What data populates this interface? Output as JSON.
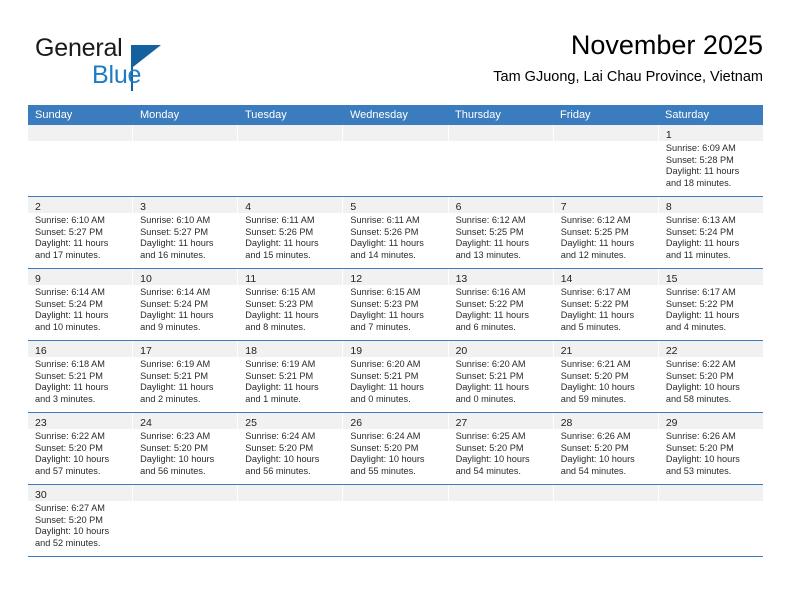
{
  "brand": {
    "word1": "General",
    "word2": "Blue",
    "logo_icon": "triangle-flag-icon"
  },
  "header": {
    "title": "November 2025",
    "subtitle": "Tam GJuong, Lai Chau Province, Vietnam"
  },
  "calendar": {
    "weekday_headers": [
      "Sunday",
      "Monday",
      "Tuesday",
      "Wednesday",
      "Thursday",
      "Friday",
      "Saturday"
    ],
    "accent_color": "#3a7cbd",
    "daycell_header_color": "#f1f1f1",
    "weeks": [
      [
        {
          "day": "",
          "empty": true
        },
        {
          "day": "",
          "empty": true
        },
        {
          "day": "",
          "empty": true
        },
        {
          "day": "",
          "empty": true
        },
        {
          "day": "",
          "empty": true
        },
        {
          "day": "",
          "empty": true
        },
        {
          "day": "1",
          "sunrise": "Sunrise: 6:09 AM",
          "sunset": "Sunset: 5:28 PM",
          "daylight1": "Daylight: 11 hours",
          "daylight2": "and 18 minutes."
        }
      ],
      [
        {
          "day": "2",
          "sunrise": "Sunrise: 6:10 AM",
          "sunset": "Sunset: 5:27 PM",
          "daylight1": "Daylight: 11 hours",
          "daylight2": "and 17 minutes."
        },
        {
          "day": "3",
          "sunrise": "Sunrise: 6:10 AM",
          "sunset": "Sunset: 5:27 PM",
          "daylight1": "Daylight: 11 hours",
          "daylight2": "and 16 minutes."
        },
        {
          "day": "4",
          "sunrise": "Sunrise: 6:11 AM",
          "sunset": "Sunset: 5:26 PM",
          "daylight1": "Daylight: 11 hours",
          "daylight2": "and 15 minutes."
        },
        {
          "day": "5",
          "sunrise": "Sunrise: 6:11 AM",
          "sunset": "Sunset: 5:26 PM",
          "daylight1": "Daylight: 11 hours",
          "daylight2": "and 14 minutes."
        },
        {
          "day": "6",
          "sunrise": "Sunrise: 6:12 AM",
          "sunset": "Sunset: 5:25 PM",
          "daylight1": "Daylight: 11 hours",
          "daylight2": "and 13 minutes."
        },
        {
          "day": "7",
          "sunrise": "Sunrise: 6:12 AM",
          "sunset": "Sunset: 5:25 PM",
          "daylight1": "Daylight: 11 hours",
          "daylight2": "and 12 minutes."
        },
        {
          "day": "8",
          "sunrise": "Sunrise: 6:13 AM",
          "sunset": "Sunset: 5:24 PM",
          "daylight1": "Daylight: 11 hours",
          "daylight2": "and 11 minutes."
        }
      ],
      [
        {
          "day": "9",
          "sunrise": "Sunrise: 6:14 AM",
          "sunset": "Sunset: 5:24 PM",
          "daylight1": "Daylight: 11 hours",
          "daylight2": "and 10 minutes."
        },
        {
          "day": "10",
          "sunrise": "Sunrise: 6:14 AM",
          "sunset": "Sunset: 5:24 PM",
          "daylight1": "Daylight: 11 hours",
          "daylight2": "and 9 minutes."
        },
        {
          "day": "11",
          "sunrise": "Sunrise: 6:15 AM",
          "sunset": "Sunset: 5:23 PM",
          "daylight1": "Daylight: 11 hours",
          "daylight2": "and 8 minutes."
        },
        {
          "day": "12",
          "sunrise": "Sunrise: 6:15 AM",
          "sunset": "Sunset: 5:23 PM",
          "daylight1": "Daylight: 11 hours",
          "daylight2": "and 7 minutes."
        },
        {
          "day": "13",
          "sunrise": "Sunrise: 6:16 AM",
          "sunset": "Sunset: 5:22 PM",
          "daylight1": "Daylight: 11 hours",
          "daylight2": "and 6 minutes."
        },
        {
          "day": "14",
          "sunrise": "Sunrise: 6:17 AM",
          "sunset": "Sunset: 5:22 PM",
          "daylight1": "Daylight: 11 hours",
          "daylight2": "and 5 minutes."
        },
        {
          "day": "15",
          "sunrise": "Sunrise: 6:17 AM",
          "sunset": "Sunset: 5:22 PM",
          "daylight1": "Daylight: 11 hours",
          "daylight2": "and 4 minutes."
        }
      ],
      [
        {
          "day": "16",
          "sunrise": "Sunrise: 6:18 AM",
          "sunset": "Sunset: 5:21 PM",
          "daylight1": "Daylight: 11 hours",
          "daylight2": "and 3 minutes."
        },
        {
          "day": "17",
          "sunrise": "Sunrise: 6:19 AM",
          "sunset": "Sunset: 5:21 PM",
          "daylight1": "Daylight: 11 hours",
          "daylight2": "and 2 minutes."
        },
        {
          "day": "18",
          "sunrise": "Sunrise: 6:19 AM",
          "sunset": "Sunset: 5:21 PM",
          "daylight1": "Daylight: 11 hours",
          "daylight2": "and 1 minute."
        },
        {
          "day": "19",
          "sunrise": "Sunrise: 6:20 AM",
          "sunset": "Sunset: 5:21 PM",
          "daylight1": "Daylight: 11 hours",
          "daylight2": "and 0 minutes."
        },
        {
          "day": "20",
          "sunrise": "Sunrise: 6:20 AM",
          "sunset": "Sunset: 5:21 PM",
          "daylight1": "Daylight: 11 hours",
          "daylight2": "and 0 minutes."
        },
        {
          "day": "21",
          "sunrise": "Sunrise: 6:21 AM",
          "sunset": "Sunset: 5:20 PM",
          "daylight1": "Daylight: 10 hours",
          "daylight2": "and 59 minutes."
        },
        {
          "day": "22",
          "sunrise": "Sunrise: 6:22 AM",
          "sunset": "Sunset: 5:20 PM",
          "daylight1": "Daylight: 10 hours",
          "daylight2": "and 58 minutes."
        }
      ],
      [
        {
          "day": "23",
          "sunrise": "Sunrise: 6:22 AM",
          "sunset": "Sunset: 5:20 PM",
          "daylight1": "Daylight: 10 hours",
          "daylight2": "and 57 minutes."
        },
        {
          "day": "24",
          "sunrise": "Sunrise: 6:23 AM",
          "sunset": "Sunset: 5:20 PM",
          "daylight1": "Daylight: 10 hours",
          "daylight2": "and 56 minutes."
        },
        {
          "day": "25",
          "sunrise": "Sunrise: 6:24 AM",
          "sunset": "Sunset: 5:20 PM",
          "daylight1": "Daylight: 10 hours",
          "daylight2": "and 56 minutes."
        },
        {
          "day": "26",
          "sunrise": "Sunrise: 6:24 AM",
          "sunset": "Sunset: 5:20 PM",
          "daylight1": "Daylight: 10 hours",
          "daylight2": "and 55 minutes."
        },
        {
          "day": "27",
          "sunrise": "Sunrise: 6:25 AM",
          "sunset": "Sunset: 5:20 PM",
          "daylight1": "Daylight: 10 hours",
          "daylight2": "and 54 minutes."
        },
        {
          "day": "28",
          "sunrise": "Sunrise: 6:26 AM",
          "sunset": "Sunset: 5:20 PM",
          "daylight1": "Daylight: 10 hours",
          "daylight2": "and 54 minutes."
        },
        {
          "day": "29",
          "sunrise": "Sunrise: 6:26 AM",
          "sunset": "Sunset: 5:20 PM",
          "daylight1": "Daylight: 10 hours",
          "daylight2": "and 53 minutes."
        }
      ],
      [
        {
          "day": "30",
          "sunrise": "Sunrise: 6:27 AM",
          "sunset": "Sunset: 5:20 PM",
          "daylight1": "Daylight: 10 hours",
          "daylight2": "and 52 minutes."
        },
        {
          "day": "",
          "empty": true
        },
        {
          "day": "",
          "empty": true
        },
        {
          "day": "",
          "empty": true
        },
        {
          "day": "",
          "empty": true
        },
        {
          "day": "",
          "empty": true
        },
        {
          "day": "",
          "empty": true
        }
      ]
    ]
  }
}
